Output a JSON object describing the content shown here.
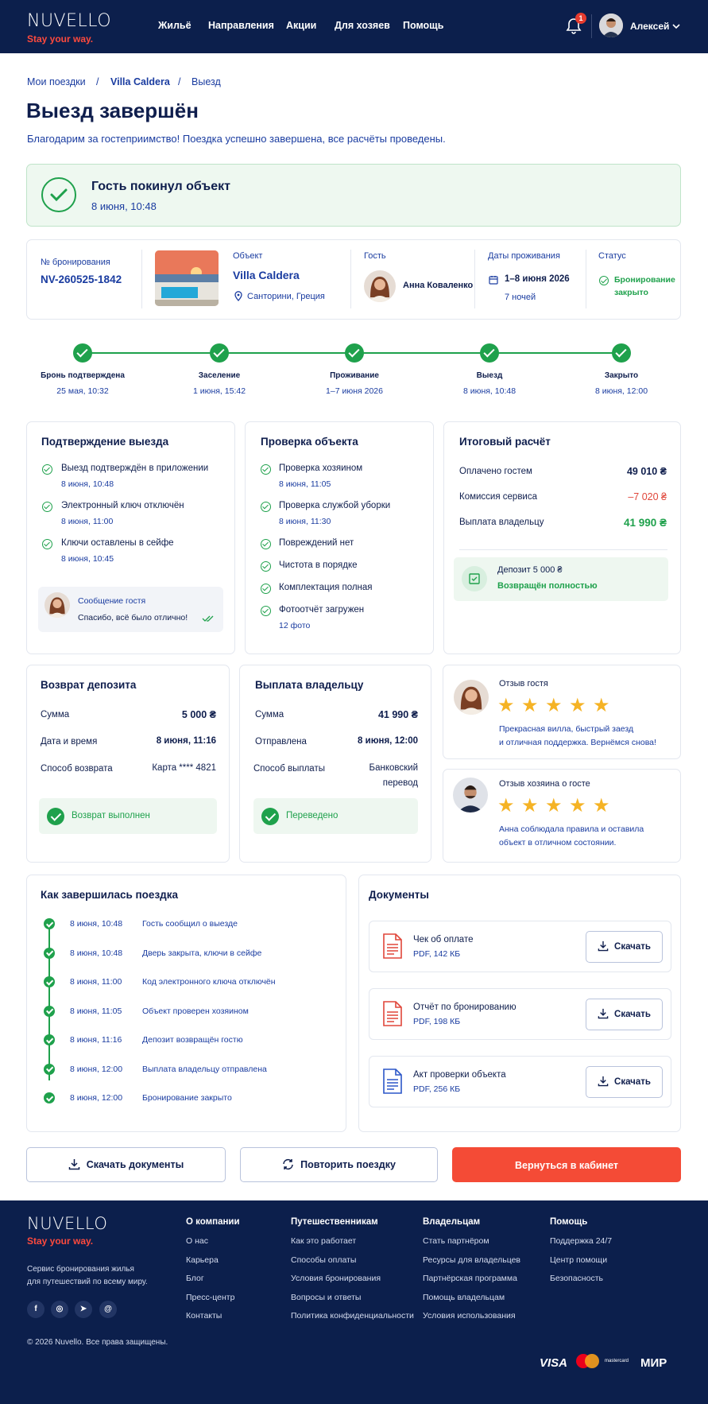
{
  "brand": {
    "name": "NUVELLO",
    "tagline": "Stay your way."
  },
  "nav": [
    "Жильё",
    "Направления",
    "Акции",
    "Для хозяев",
    "Помощь"
  ],
  "notif_count": "1",
  "user": {
    "name": "Алексей"
  },
  "breadcrumb": [
    "Мои поездки",
    "/",
    "Villa Caldera",
    "/",
    "Выезд"
  ],
  "page": {
    "title": "Выезд завершён",
    "subtitle": "Благодарим за гостеприимство! Поездка успешно завершена, все расчёты проведены."
  },
  "banner": {
    "title": "Гость покинул объект",
    "time": "8 июня, 10:48"
  },
  "booking": {
    "num_label": "№ бронирования",
    "num": "NV-260525-1842",
    "obj_label": "Объект",
    "obj_name": "Villa Caldera",
    "obj_loc": "Санторини, Греция",
    "guest_label": "Гость",
    "guest_name": "Анна Коваленко",
    "dates_label": "Даты проживания",
    "dates": "1–8 июня 2026",
    "nights": "7 ночей",
    "status_label": "Статус",
    "status_l1": "Бронирование",
    "status_l2": "закрыто"
  },
  "timeline": [
    {
      "t": "Бронь подтверждена",
      "d": "25 мая, 10:32"
    },
    {
      "t": "Заселение",
      "d": "1 июня, 15:42"
    },
    {
      "t": "Проживание",
      "d": "1–7 июня 2026"
    },
    {
      "t": "Выезд",
      "d": "8 июня, 10:48"
    },
    {
      "t": "Закрыто",
      "d": "8 июня, 12:00"
    }
  ],
  "confirm": {
    "title": "Подтверждение выезда",
    "items": [
      {
        "t": "Выезд подтверждён в приложении",
        "d": "8 июня, 10:48"
      },
      {
        "t": "Электронный ключ отключён",
        "d": "8 июня, 11:00"
      },
      {
        "t": "Ключи оставлены в сейфе",
        "d": "8 июня, 10:45"
      }
    ],
    "msg_title": "Сообщение гостя",
    "msg": "Спасибо, всё было отлично!"
  },
  "inspect": {
    "title": "Проверка объекта",
    "items": [
      {
        "t": "Проверка хозяином",
        "d": "8 июня, 11:05"
      },
      {
        "t": "Проверка службой уборки",
        "d": "8 июня, 11:30"
      },
      {
        "t": "Повреждений нет",
        "d": ""
      },
      {
        "t": "Чистота в порядке",
        "d": ""
      },
      {
        "t": "Комплектация полная",
        "d": ""
      },
      {
        "t": "Фотоотчёт загружен",
        "d": "12 фото"
      }
    ]
  },
  "total": {
    "title": "Итоговый расчёт",
    "rows": [
      {
        "l": "Оплачено гостем",
        "v": "49 010 ₴"
      },
      {
        "l": "Комиссия сервиса",
        "v": "–7 020 ₴"
      },
      {
        "l": "Выплата владельцу",
        "v": "41 990 ₴"
      }
    ],
    "dep1": "Депозит 5 000 ₴",
    "dep2": "Возвращён полностью"
  },
  "refund": {
    "title": "Возврат депозита",
    "rows": [
      {
        "l": "Сумма",
        "v": "5 000 ₴"
      },
      {
        "l": "Дата и время",
        "v": "8 июня, 11:16"
      },
      {
        "l": "Способ возврата",
        "v": "Карта **** 4821"
      }
    ],
    "status": "Возврат выполнен"
  },
  "payout": {
    "title": "Выплата владельцу",
    "rows": [
      {
        "l": "Сумма",
        "v": "41 990 ₴"
      },
      {
        "l": "Отправлена",
        "v": "8 июня, 12:00"
      },
      {
        "l": "Способ выплаты",
        "v": "Банковский",
        "v2": "перевод"
      }
    ],
    "status": "Переведено"
  },
  "review_guest": {
    "title": "Отзыв гостя",
    "rating": 5,
    "l1": "Прекрасная вилла, быстрый заезд",
    "l2": "и отличная поддержка. Вернёмся снова!"
  },
  "review_host": {
    "title": "Отзыв хозяина о госте",
    "rating": 5,
    "l1": "Анна соблюдала правила и оставила",
    "l2": "объект в отличном состоянии."
  },
  "log": {
    "title": "Как завершилась поездка",
    "items": [
      {
        "t": "8 июня, 10:48",
        "e": "Гость сообщил о выезде"
      },
      {
        "t": "8 июня, 10:48",
        "e": "Дверь закрыта, ключи в сейфе"
      },
      {
        "t": "8 июня, 11:00",
        "e": "Код электронного ключа отключён"
      },
      {
        "t": "8 июня, 11:05",
        "e": "Объект проверен хозяином"
      },
      {
        "t": "8 июня, 11:16",
        "e": "Депозит возвращён гостю"
      },
      {
        "t": "8 июня, 12:00",
        "e": "Выплата владельцу отправлена"
      },
      {
        "t": "8 июня, 12:00",
        "e": "Бронирование закрыто"
      }
    ]
  },
  "docs": {
    "title": "Документы",
    "items": [
      {
        "n": "Чек об оплате",
        "m": "PDF, 142 КБ",
        "c": "#e0463a"
      },
      {
        "n": "Отчёт по бронированию",
        "m": "PDF, 198 КБ",
        "c": "#e0463a"
      },
      {
        "n": "Акт проверки объекта",
        "m": "PDF, 256 КБ",
        "c": "#2b56c8"
      }
    ],
    "download": "Скачать"
  },
  "actions": {
    "docs": "Скачать документы",
    "repeat": "Повторить поездку",
    "back": "Вернуться в кабинет"
  },
  "footer": {
    "about": "Сервис бронирования жилья",
    "about2": "для путешествий по всему миру.",
    "cols": [
      {
        "h": "О компании",
        "i": [
          "О нас",
          "Карьера",
          "Блог",
          "Пресс-центр",
          "Контакты"
        ]
      },
      {
        "h": "Путешественникам",
        "i": [
          "Как это работает",
          "Способы оплаты",
          "Условия бронирования",
          "Вопросы и ответы",
          "Политика конфиденциальности"
        ]
      },
      {
        "h": "Владельцам",
        "i": [
          "Стать партнёром",
          "Ресурсы для владельцев",
          "Партнёрская программа",
          "Помощь владельцам",
          "Условия использования"
        ]
      },
      {
        "h": "Помощь",
        "i": [
          "Поддержка 24/7",
          "Центр помощи",
          "Безопасность"
        ]
      }
    ],
    "copy": "© 2026 Nuvello. Все права защищены.",
    "pay": [
      "VISA",
      "mastercard",
      "МИР"
    ]
  },
  "colors": {
    "navy": "#0c1f4c",
    "green": "#1fa14c",
    "accent": "#ff4a3d"
  }
}
